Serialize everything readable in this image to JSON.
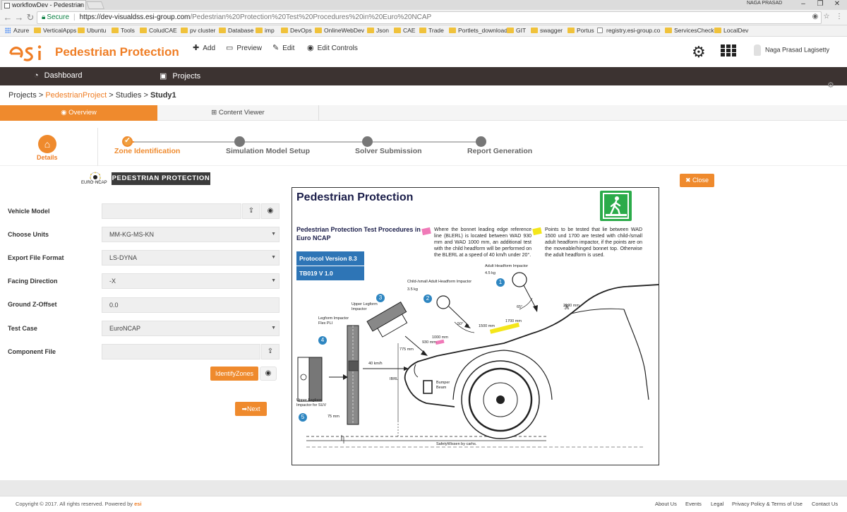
{
  "browser": {
    "tab_title": "workflowDev - Pedestrian",
    "window_user": "NAGA PRASAD",
    "secure_label": "Secure",
    "url_host": "https://dev-visualdss.esi-group.com",
    "url_path": "/Pedestrian%20Protection%20Test%20Procedures%20in%20Euro%20NCAP",
    "bookmarks": [
      "Azure",
      "VerticalApps",
      "Ubuntu",
      "Tools",
      "ColudCAE",
      "pv cluster",
      "Database",
      "imp",
      "DevOps",
      "OnlineWebDev",
      "Json",
      "CAE",
      "Trade",
      "Portlets_download",
      "GIT",
      "swagger",
      "Portus",
      "registry.esi-group.co",
      "ServicesCheck",
      "LocalDev"
    ]
  },
  "header": {
    "app_title": "Pedestrian Protection",
    "tools": {
      "add": "Add",
      "preview": "Preview",
      "edit": "Edit",
      "edit_controls": "Edit Controls"
    },
    "user_name": "Naga Prasad Lagisetty"
  },
  "nav": {
    "dashboard": "Dashboard",
    "projects": "Projects"
  },
  "breadcrumb": {
    "projects": "Projects",
    "sep": ">",
    "project": "PedestrianProject",
    "studies": "Studies",
    "study": "Study1"
  },
  "tabs": {
    "overview": "Overview",
    "content_viewer": "Content Viewer"
  },
  "steps": {
    "details": "Details",
    "items": [
      "Zone Identification",
      "Simulation Model Setup",
      "Solver Submission",
      "Report Generation"
    ]
  },
  "form": {
    "banner": "PEDESTRIAN PROTECTION",
    "badge": {
      "line1": "EURO",
      "line2": "NCAP"
    },
    "fields": [
      {
        "label": "Vehicle Model",
        "value": ""
      },
      {
        "label": "Choose Units",
        "value": "MM-KG-MS-KN"
      },
      {
        "label": "Export File Format",
        "value": "LS-DYNA"
      },
      {
        "label": "Facing Direction",
        "value": "-X"
      },
      {
        "label": "Ground Z-Offset",
        "value": "0.0"
      },
      {
        "label": "Test Case",
        "value": "EuroNCAP"
      },
      {
        "label": "Component File",
        "value": ""
      }
    ],
    "identify_zones": "IdentifyZones",
    "next": "Next",
    "close": "Close"
  },
  "document": {
    "title": "Pedestrian Protection",
    "subtitle": "Pedestrian Protection Test Procedures in Euro NCAP",
    "protocol": "Protocol Version 8.3",
    "tb": "TB019  V 1.0",
    "note_pink": "Where the bonnet leading edge reference line (BLERL) is located between WAD 930 mm and WAD 1000 mm, an additional test with the child headform will be performed on the BLERL at a speed of 40 km/h under 20°.",
    "note_yellow": "Points to be tested that lie between WAD 1500 und 1700 are tested with child-/small adult headform impactor, if the points are on the moveable/hinged bonnet top. Otherwise the adult headform is used.",
    "labels": {
      "adult_head": "Adult Headform Impactor",
      "adult_mass": "4.5 kg",
      "child_head": "Child-/small Adult Headform Impactor",
      "child_mass": "3.5 kg",
      "upper_leg": "Upper Legform Impactor",
      "legform": "Legform Impactor Flex PLI",
      "upper_leg_suv": "Upper Legform Impactor for SUV",
      "speed_40": "40 km/h",
      "angle_50": "50°",
      "angle_65": "65°",
      "d2100": "2100 mm",
      "d1700": "1700 mm",
      "d1500": "1500 mm",
      "d1000": "1000 mm",
      "d930": "930 mm",
      "d775": "775 mm",
      "d75": "75 mm",
      "ibrl": "IBRL",
      "bumper": "Bumper Beam",
      "credit": "SafetyWissen by carhs."
    },
    "numbers": [
      "1",
      "2",
      "3",
      "4",
      "5"
    ]
  },
  "footer": {
    "copyright": "Copyright © 2017. All rights reserved. Powered by",
    "links": [
      "About Us",
      "Events",
      "Legal",
      "Privacy Policy & Terms of Use",
      "Contact Us"
    ]
  },
  "colors": {
    "accent": "#ef8a2d",
    "nav_bg": "#3c3331",
    "doc_blue": "#2e75b6",
    "ped_green": "#2bab4a"
  }
}
